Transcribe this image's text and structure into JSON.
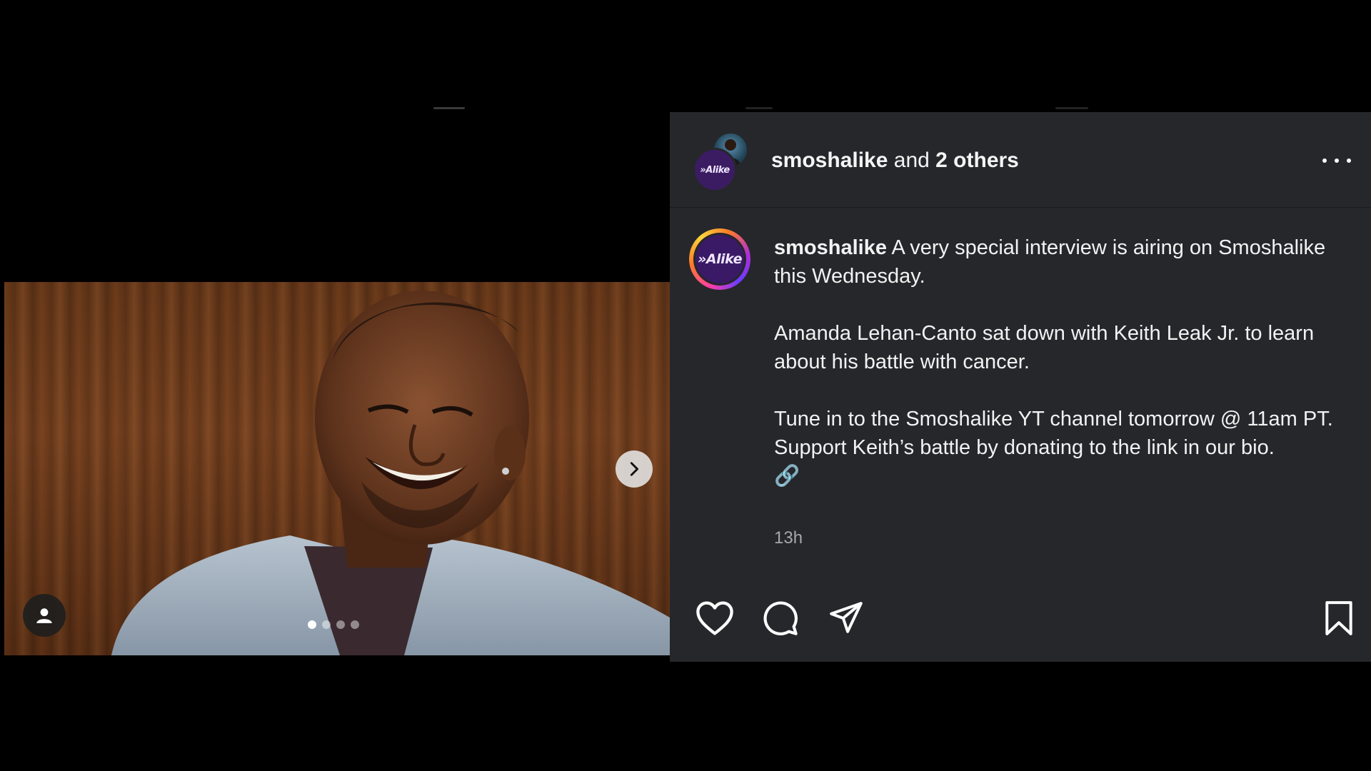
{
  "post": {
    "header": {
      "username": "smoshalike",
      "joiner": " and ",
      "others": "2 others"
    },
    "caption": {
      "username": "smoshalike",
      "line1_rest": " A very special interview is airing on Smoshalike this Wednesday.",
      "para2": "Amanda Lehan-Canto sat down with Keith Leak Jr. to learn about his battle with cancer.",
      "para3": "Tune in to the Smoshalike YT channel tomorrow @ 11am PT.",
      "para4": "Support Keith’s battle by donating to the link in our bio.",
      "emoji": "🔗"
    },
    "timestamp": "13h",
    "logo_text": "»Alike",
    "carousel": {
      "total_slides": 4,
      "active_index": 0
    }
  },
  "icons": {
    "like": "heart-icon",
    "comment": "comment-icon",
    "share": "send-icon",
    "save": "bookmark-icon",
    "more": "more-horizontal-icon",
    "next": "chevron-right-icon",
    "tag": "user-tag-icon"
  },
  "colors": {
    "panel_bg": "#26272b",
    "page_bg": "#000000",
    "brand_purple": "#3a1a66",
    "story_ring": "gradient-pink-orange-purple"
  }
}
